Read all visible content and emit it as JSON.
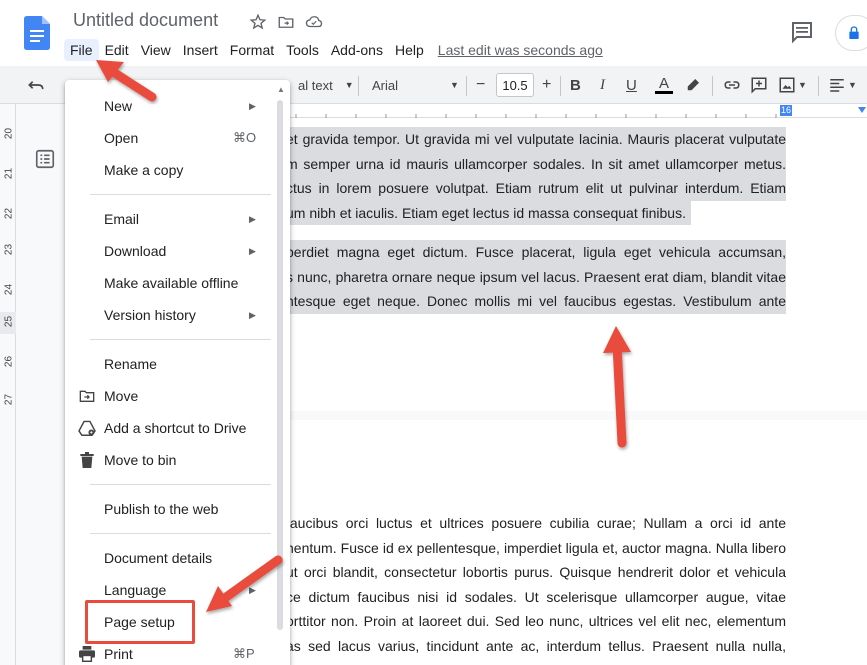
{
  "header": {
    "doc_title": "Untitled document",
    "menu": [
      "File",
      "Edit",
      "View",
      "Insert",
      "Format",
      "Tools",
      "Add-ons",
      "Help"
    ],
    "last_edit": "Last edit was seconds ago"
  },
  "toolbar": {
    "style": "al text",
    "font": "Arial",
    "font_size": "10.5",
    "bold": "B",
    "italic": "I",
    "underline": "U",
    "text_color": "A"
  },
  "ruler": {
    "h_marker": "16",
    "v_labels": [
      "20",
      "21",
      "22",
      "23",
      "24",
      "25",
      "26",
      "27"
    ]
  },
  "file_menu": {
    "items": [
      {
        "label": "New",
        "submenu": true
      },
      {
        "label": "Open",
        "shortcut": "⌘O"
      },
      {
        "label": "Make a copy"
      },
      {
        "label": "Email",
        "submenu": true
      },
      {
        "label": "Download",
        "submenu": true
      },
      {
        "label": "Make available offline"
      },
      {
        "label": "Version history",
        "submenu": true
      },
      {
        "label": "Rename"
      },
      {
        "label": "Move",
        "icon": "folder-move-icon"
      },
      {
        "label": "Add a shortcut to Drive",
        "icon": "drive-shortcut-icon"
      },
      {
        "label": "Move to bin",
        "icon": "trash-icon"
      },
      {
        "label": "Publish to the web"
      },
      {
        "label": "Document details"
      },
      {
        "label": "Language",
        "submenu": true
      },
      {
        "label": "Page setup"
      },
      {
        "label": "Print",
        "shortcut": "⌘P",
        "icon": "printer-icon"
      }
    ]
  },
  "document": {
    "page1_para1": [
      "et gravida tempor. Ut gravida mi vel vulputate lacinia. Mauris placerat vulputate",
      "m semper urna id mauris ullamcorper sodales. In sit amet ullamcorper metus.",
      "ctus in lorem posuere volutpat. Etiam rutrum elit ut pulvinar interdum. Etiam",
      "um nibh et iaculis. Etiam eget lectus id massa consequat finibus."
    ],
    "page1_para2": [
      "perdiet magna eget dictum. Fusce placerat, ligula eget vehicula accumsan,",
      "s nunc, pharetra ornare neque ipsum vel lacus. Praesent erat diam, blandit vitae",
      "ntesque eget neque. Donec mollis mi vel faucibus egestas. Vestibulum ante"
    ],
    "page2_para": [
      "faucibus orci luctus et ultrices posuere cubilia curae; Nullam a orci id ante",
      "nentum. Fusce id ex pellentesque, imperdiet ligula et, auctor magna. Nulla libero",
      "ut orci blandit, consectetur lobortis purus. Quisque hendrerit dolor et vehicula",
      "ce dictum faucibus nisi id sodales. Ut scelerisque ullamcorper augue, vitae",
      "orttitor non. Proin at laoreet dui. Sed leo nunc, ultrices vel elit nec, elementum",
      "as sed lacus varius, tincidunt ante ac, interdum tellus. Praesent nulla nulla,"
    ]
  },
  "colors": {
    "annotation_red": "#e94b3c",
    "selection_gray": "#dadce0",
    "docs_blue": "#4285f4"
  }
}
